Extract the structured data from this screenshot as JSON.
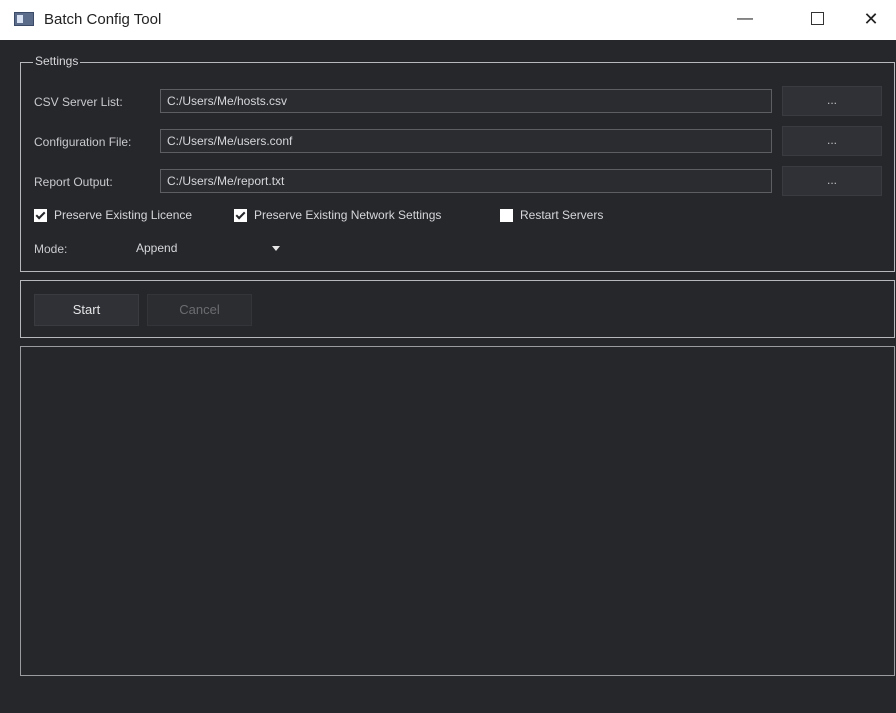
{
  "window": {
    "title": "Batch Config Tool",
    "minimize": "—",
    "close": "✕"
  },
  "settings": {
    "group_title": "Settings",
    "csv": {
      "label": "CSV Server List:",
      "value": "C:/Users/Me/hosts.csv",
      "browse": "..."
    },
    "config": {
      "label": "Configuration File:",
      "value": "C:/Users/Me/users.conf",
      "browse": "..."
    },
    "report": {
      "label": "Report Output:",
      "value": "C:/Users/Me/report.txt",
      "browse": "..."
    },
    "options": [
      {
        "label": "Preserve Existing Licence",
        "checked": true
      },
      {
        "label": "Preserve Existing Network Settings",
        "checked": true
      },
      {
        "label": "Restart Servers",
        "checked": false
      }
    ],
    "mode": {
      "label": "Mode:",
      "value": "Append"
    }
  },
  "actions": {
    "start": "Start",
    "cancel": "Cancel",
    "cancel_enabled": false
  },
  "log": {
    "content": ""
  },
  "colors": {
    "background": "#26272b",
    "titlebar": "#ffffff",
    "text": "#cfd0d3",
    "disabled_text": "#6b6c70"
  }
}
